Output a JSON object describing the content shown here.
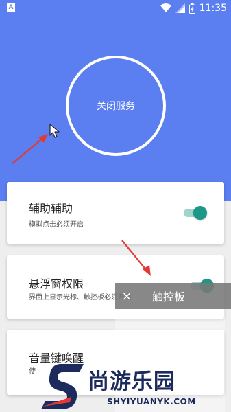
{
  "status_bar": {
    "left_icon": "A",
    "time": "11:35",
    "icons": [
      "wifi-icon",
      "signal-icon",
      "battery-icon"
    ]
  },
  "service": {
    "label": "关闭服务"
  },
  "cards": [
    {
      "title": "辅助辅助",
      "desc": "模拟点击必须开启",
      "toggle_on": true
    },
    {
      "title": "悬浮窗权限",
      "desc": "界面上显示光标、触控板必须开启",
      "toggle_on": true
    },
    {
      "title": "音量键唤醒",
      "desc": "使",
      "toggle_on": false
    }
  ],
  "touchpad": {
    "close_icon": "×",
    "label": "触控板"
  },
  "watermark": {
    "cn": "尚游乐园",
    "en": "SHYIYUANYK.COM"
  },
  "colors": {
    "hero": "#5b7ef0",
    "toggle_accent": "#1e9886",
    "arrow": "#e23a32"
  }
}
